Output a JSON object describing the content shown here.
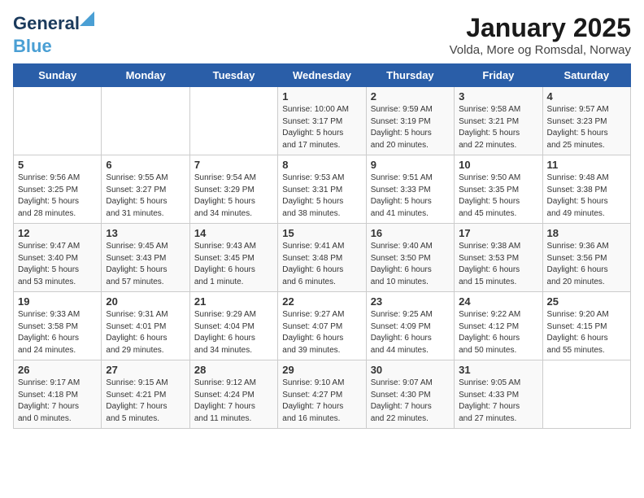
{
  "logo": {
    "line1": "General",
    "line2": "Blue"
  },
  "title": "January 2025",
  "location": "Volda, More og Romsdal, Norway",
  "weekdays": [
    "Sunday",
    "Monday",
    "Tuesday",
    "Wednesday",
    "Thursday",
    "Friday",
    "Saturday"
  ],
  "weeks": [
    [
      {
        "day": "",
        "info": ""
      },
      {
        "day": "",
        "info": ""
      },
      {
        "day": "",
        "info": ""
      },
      {
        "day": "1",
        "info": "Sunrise: 10:00 AM\nSunset: 3:17 PM\nDaylight: 5 hours\nand 17 minutes."
      },
      {
        "day": "2",
        "info": "Sunrise: 9:59 AM\nSunset: 3:19 PM\nDaylight: 5 hours\nand 20 minutes."
      },
      {
        "day": "3",
        "info": "Sunrise: 9:58 AM\nSunset: 3:21 PM\nDaylight: 5 hours\nand 22 minutes."
      },
      {
        "day": "4",
        "info": "Sunrise: 9:57 AM\nSunset: 3:23 PM\nDaylight: 5 hours\nand 25 minutes."
      }
    ],
    [
      {
        "day": "5",
        "info": "Sunrise: 9:56 AM\nSunset: 3:25 PM\nDaylight: 5 hours\nand 28 minutes."
      },
      {
        "day": "6",
        "info": "Sunrise: 9:55 AM\nSunset: 3:27 PM\nDaylight: 5 hours\nand 31 minutes."
      },
      {
        "day": "7",
        "info": "Sunrise: 9:54 AM\nSunset: 3:29 PM\nDaylight: 5 hours\nand 34 minutes."
      },
      {
        "day": "8",
        "info": "Sunrise: 9:53 AM\nSunset: 3:31 PM\nDaylight: 5 hours\nand 38 minutes."
      },
      {
        "day": "9",
        "info": "Sunrise: 9:51 AM\nSunset: 3:33 PM\nDaylight: 5 hours\nand 41 minutes."
      },
      {
        "day": "10",
        "info": "Sunrise: 9:50 AM\nSunset: 3:35 PM\nDaylight: 5 hours\nand 45 minutes."
      },
      {
        "day": "11",
        "info": "Sunrise: 9:48 AM\nSunset: 3:38 PM\nDaylight: 5 hours\nand 49 minutes."
      }
    ],
    [
      {
        "day": "12",
        "info": "Sunrise: 9:47 AM\nSunset: 3:40 PM\nDaylight: 5 hours\nand 53 minutes."
      },
      {
        "day": "13",
        "info": "Sunrise: 9:45 AM\nSunset: 3:43 PM\nDaylight: 5 hours\nand 57 minutes."
      },
      {
        "day": "14",
        "info": "Sunrise: 9:43 AM\nSunset: 3:45 PM\nDaylight: 6 hours\nand 1 minute."
      },
      {
        "day": "15",
        "info": "Sunrise: 9:41 AM\nSunset: 3:48 PM\nDaylight: 6 hours\nand 6 minutes."
      },
      {
        "day": "16",
        "info": "Sunrise: 9:40 AM\nSunset: 3:50 PM\nDaylight: 6 hours\nand 10 minutes."
      },
      {
        "day": "17",
        "info": "Sunrise: 9:38 AM\nSunset: 3:53 PM\nDaylight: 6 hours\nand 15 minutes."
      },
      {
        "day": "18",
        "info": "Sunrise: 9:36 AM\nSunset: 3:56 PM\nDaylight: 6 hours\nand 20 minutes."
      }
    ],
    [
      {
        "day": "19",
        "info": "Sunrise: 9:33 AM\nSunset: 3:58 PM\nDaylight: 6 hours\nand 24 minutes."
      },
      {
        "day": "20",
        "info": "Sunrise: 9:31 AM\nSunset: 4:01 PM\nDaylight: 6 hours\nand 29 minutes."
      },
      {
        "day": "21",
        "info": "Sunrise: 9:29 AM\nSunset: 4:04 PM\nDaylight: 6 hours\nand 34 minutes."
      },
      {
        "day": "22",
        "info": "Sunrise: 9:27 AM\nSunset: 4:07 PM\nDaylight: 6 hours\nand 39 minutes."
      },
      {
        "day": "23",
        "info": "Sunrise: 9:25 AM\nSunset: 4:09 PM\nDaylight: 6 hours\nand 44 minutes."
      },
      {
        "day": "24",
        "info": "Sunrise: 9:22 AM\nSunset: 4:12 PM\nDaylight: 6 hours\nand 50 minutes."
      },
      {
        "day": "25",
        "info": "Sunrise: 9:20 AM\nSunset: 4:15 PM\nDaylight: 6 hours\nand 55 minutes."
      }
    ],
    [
      {
        "day": "26",
        "info": "Sunrise: 9:17 AM\nSunset: 4:18 PM\nDaylight: 7 hours\nand 0 minutes."
      },
      {
        "day": "27",
        "info": "Sunrise: 9:15 AM\nSunset: 4:21 PM\nDaylight: 7 hours\nand 5 minutes."
      },
      {
        "day": "28",
        "info": "Sunrise: 9:12 AM\nSunset: 4:24 PM\nDaylight: 7 hours\nand 11 minutes."
      },
      {
        "day": "29",
        "info": "Sunrise: 9:10 AM\nSunset: 4:27 PM\nDaylight: 7 hours\nand 16 minutes."
      },
      {
        "day": "30",
        "info": "Sunrise: 9:07 AM\nSunset: 4:30 PM\nDaylight: 7 hours\nand 22 minutes."
      },
      {
        "day": "31",
        "info": "Sunrise: 9:05 AM\nSunset: 4:33 PM\nDaylight: 7 hours\nand 27 minutes."
      },
      {
        "day": "",
        "info": ""
      }
    ]
  ]
}
